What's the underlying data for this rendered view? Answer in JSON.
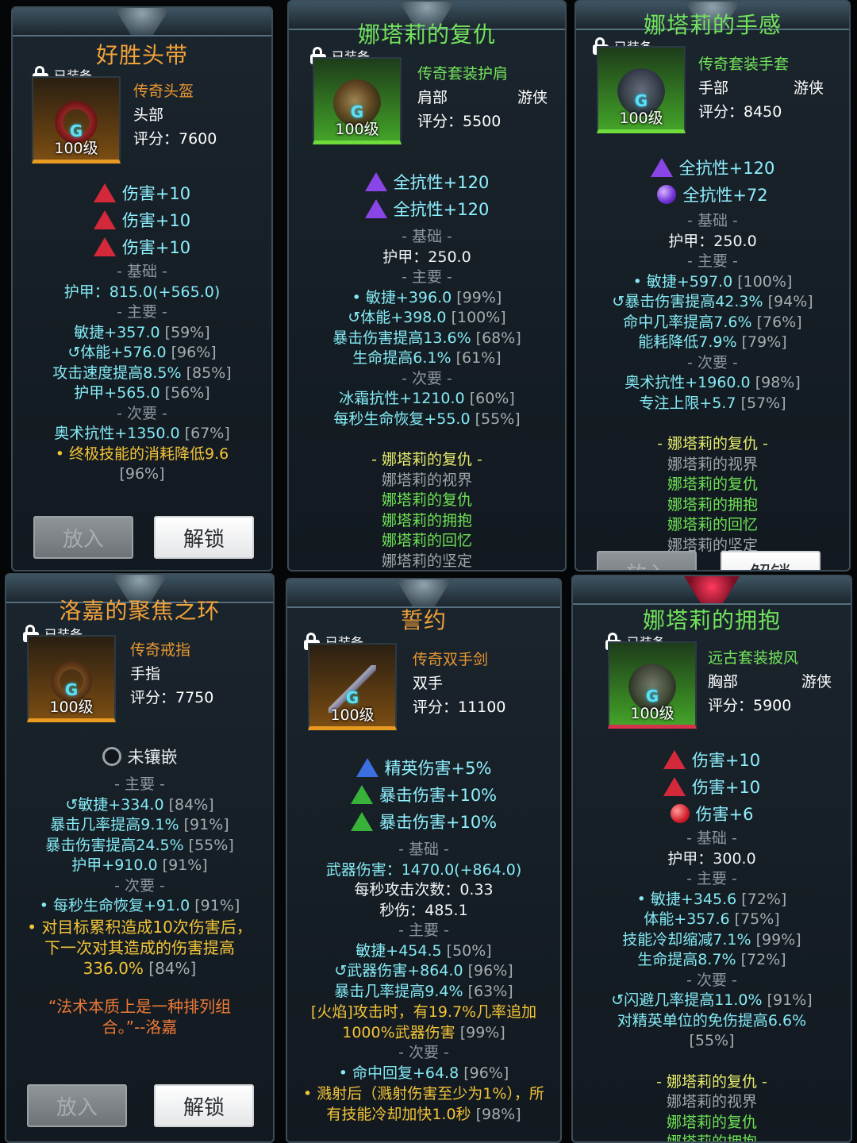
{
  "cards": [
    {
      "title": "好胜头带",
      "equipped": "已装备",
      "level": "100级",
      "quality": "传奇头盔",
      "slot": "头部",
      "class": "",
      "score": "评分：7600",
      "gems": [
        "伤害+10",
        "伤害+10",
        "伤害+10"
      ],
      "base_header": "- 基础 -",
      "base": [
        "护甲：815.0(+565.0)"
      ],
      "primary_header": "- 主要 -",
      "primary": [
        {
          "text": "敏捷+357.0",
          "pct": "[59%]"
        },
        {
          "text": "↺体能+576.0",
          "pct": "[96%]"
        },
        {
          "text": "攻击速度提高8.5%",
          "pct": "[85%]"
        },
        {
          "text": "护甲+565.0",
          "pct": "[56%]"
        }
      ],
      "secondary_header": "- 次要 -",
      "secondary": [
        {
          "text": "奥术抗性+1350.0",
          "pct": "[67%]"
        }
      ],
      "legendary": "• 终极技能的消耗降低9.6",
      "legendary_pct": "[96%]",
      "btn_put": "放入",
      "btn_unlock": "解锁"
    },
    {
      "title": "娜塔莉的复仇",
      "equipped": "已装备",
      "level": "100级",
      "quality": "传奇套装护肩",
      "slot": "肩部",
      "class": "游侠",
      "score": "评分：5500",
      "gems": [
        "全抗性+120",
        "全抗性+120"
      ],
      "base_header": "- 基础 -",
      "base": [
        "护甲：250.0"
      ],
      "primary_header": "- 主要 -",
      "primary": [
        {
          "text": "• 敏捷+396.0",
          "pct": "[99%]"
        },
        {
          "text": "↺体能+398.0",
          "pct": "[100%]"
        },
        {
          "text": "暴击伤害提高13.6%",
          "pct": "[68%]"
        },
        {
          "text": "生命提高6.1%",
          "pct": "[61%]"
        }
      ],
      "secondary_header": "- 次要 -",
      "secondary": [
        {
          "text": "冰霜抗性+1210.0",
          "pct": "[60%]"
        },
        {
          "text": "每秒生命恢复+55.0",
          "pct": "[55%]"
        }
      ],
      "set_header": "- 娜塔莉的复仇 -",
      "set_items": [
        "娜塔莉的视界",
        "娜塔莉的复仇",
        "娜塔莉的拥抱",
        "娜塔莉的回忆",
        "娜塔莉的坚定"
      ]
    },
    {
      "title": "娜塔莉的手感",
      "equipped": "已装备",
      "level": "100级",
      "quality": "传奇套装手套",
      "slot": "手部",
      "class": "游侠",
      "score": "评分：8450",
      "gems": [
        "全抗性+120",
        "全抗性+72"
      ],
      "base_header": "- 基础 -",
      "base": [
        "护甲：250.0"
      ],
      "primary_header": "- 主要 -",
      "primary": [
        {
          "text": "• 敏捷+597.0",
          "pct": "[100%]"
        },
        {
          "text": "↺暴击伤害提高42.3%",
          "pct": "[94%]"
        },
        {
          "text": "命中几率提高7.6%",
          "pct": "[76%]"
        },
        {
          "text": "能耗降低7.9%",
          "pct": "[79%]"
        }
      ],
      "secondary_header": "- 次要 -",
      "secondary": [
        {
          "text": "奥术抗性+1960.0",
          "pct": "[98%]"
        },
        {
          "text": "专注上限+5.7",
          "pct": "[57%]"
        }
      ],
      "set_header": "- 娜塔莉的复仇 -",
      "set_items": [
        "娜塔莉的视界",
        "娜塔莉的复仇",
        "娜塔莉的拥抱",
        "娜塔莉的回忆",
        "娜塔莉的坚定"
      ],
      "btn_put": "放入",
      "btn_unlock": "解锁"
    },
    {
      "title": "洛嘉的聚焦之环",
      "equipped": "已装备",
      "level": "100级",
      "quality": "传奇戒指",
      "slot": "手指",
      "class": "",
      "score": "评分：7750",
      "socket": "未镶嵌",
      "primary_header": "- 主要 -",
      "primary": [
        {
          "text": "↺敏捷+334.0",
          "pct": "[84%]"
        },
        {
          "text": "暴击几率提高9.1%",
          "pct": "[91%]"
        },
        {
          "text": "暴击伤害提高24.5%",
          "pct": "[55%]"
        },
        {
          "text": "护甲+910.0",
          "pct": "[91%]"
        }
      ],
      "secondary_header": "- 次要 -",
      "secondary": [
        {
          "text": "• 每秒生命恢复+91.0",
          "pct": "[91%]"
        }
      ],
      "legendary": "• 对目标累积造成10次伤害后，下一次对其造成的伤害提高336.0%",
      "legendary_pct": "[84%]",
      "quote": "“法术本质上是一种排列组合。”--洛嘉",
      "btn_put": "放入",
      "btn_unlock": "解锁"
    },
    {
      "title": "誓约",
      "equipped": "已装备",
      "level": "100级",
      "quality": "传奇双手剑",
      "slot": "双手",
      "class": "",
      "score": "评分：11100",
      "gems": [
        "精英伤害+5%",
        "暴击伤害+10%",
        "暴击伤害+10%"
      ],
      "base_header": "- 基础 -",
      "base": [
        "武器伤害：1470.0(+864.0)",
        "每秒攻击次数：0.33",
        "秒伤：485.1"
      ],
      "primary_header": "- 主要 -",
      "primary": [
        {
          "text": "敏捷+454.5",
          "pct": "[50%]"
        },
        {
          "text": "↺武器伤害+864.0",
          "pct": "[96%]"
        },
        {
          "text": "暴击几率提高9.4%",
          "pct": "[63%]"
        }
      ],
      "legendary": "[火焰]攻击时，有19.7%几率追加1000%武器伤害",
      "legendary_pct": "[99%]",
      "secondary_header": "- 次要 -",
      "secondary": [
        {
          "text": "• 命中回复+64.8",
          "pct": "[96%]"
        }
      ],
      "legendary2": "• 溅射后（溅射伤害至少为1%），所有技能冷却加快1.0秒",
      "legendary2_pct": "[98%]"
    },
    {
      "title": "娜塔莉的拥抱",
      "equipped": "已装备",
      "level": "100级",
      "quality": "远古套装披风",
      "slot": "胸部",
      "class": "游侠",
      "score": "评分：5900",
      "gems": [
        "伤害+10",
        "伤害+10",
        "伤害+6"
      ],
      "base_header": "- 基础 -",
      "base": [
        "护甲：300.0"
      ],
      "primary_header": "- 主要 -",
      "primary": [
        {
          "text": "• 敏捷+345.6",
          "pct": "[72%]"
        },
        {
          "text": "体能+357.6",
          "pct": "[75%]"
        },
        {
          "text": "技能冷却缩减7.1%",
          "pct": "[99%]"
        },
        {
          "text": "生命提高8.7%",
          "pct": "[72%]"
        }
      ],
      "secondary_header": "- 次要 -",
      "secondary": [
        {
          "text": "↺闪避几率提高11.0%",
          "pct": "[91%]"
        },
        {
          "text": "对精英单位的免伤提高6.6%",
          "pct": "[55%]"
        }
      ],
      "set_header": "- 娜塔莉的复仇 -",
      "set_items": [
        "娜塔莉的视界",
        "娜塔莉的复仇",
        "娜塔莉的拥抱"
      ]
    }
  ]
}
